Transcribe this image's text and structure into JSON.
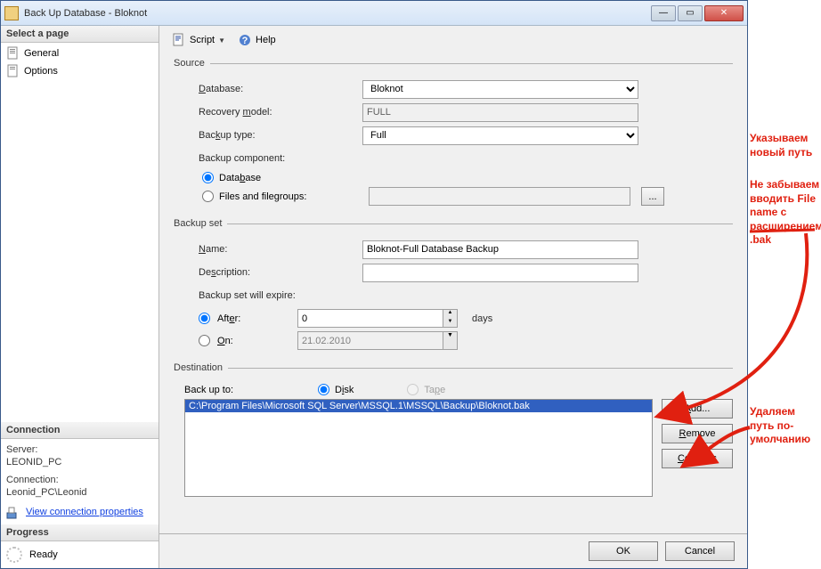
{
  "window": {
    "title": "Back Up Database - Bloknot"
  },
  "sidebar": {
    "select_page": "Select a page",
    "items": [
      {
        "label": "General"
      },
      {
        "label": "Options"
      }
    ],
    "connection_header": "Connection",
    "server_label": "Server:",
    "server_value": "LEONID_PC",
    "connection_label": "Connection:",
    "connection_value": "Leonid_PC\\Leonid",
    "view_properties": "View connection properties",
    "progress_header": "Progress",
    "progress_status": "Ready"
  },
  "toolbar": {
    "script": "Script",
    "help": "Help"
  },
  "source": {
    "legend": "Source",
    "database_label": "Database:",
    "database_value": "Bloknot",
    "recovery_label": "Recovery model:",
    "recovery_value": "FULL",
    "backup_type_label": "Backup type:",
    "backup_type_value": "Full",
    "component_label": "Backup component:",
    "radio_database": "Database",
    "radio_files": "Files and filegroups:",
    "browse": "..."
  },
  "backup_set": {
    "legend": "Backup set",
    "name_label": "Name:",
    "name_value": "Bloknot-Full Database Backup",
    "description_label": "Description:",
    "description_value": "",
    "expire_label": "Backup set will expire:",
    "after_label": "After:",
    "after_value": "0",
    "after_units": "days",
    "on_label": "On:",
    "on_value": "21.02.2010"
  },
  "destination": {
    "legend": "Destination",
    "backup_to_label": "Back up to:",
    "radio_disk": "Disk",
    "radio_tape": "Tape",
    "path": "C:\\Program Files\\Microsoft SQL Server\\MSSQL.1\\MSSQL\\Backup\\Bloknot.bak",
    "add": "Add...",
    "remove": "Remove",
    "contents": "Contents"
  },
  "buttons": {
    "ok": "OK",
    "cancel": "Cancel"
  },
  "annotations": {
    "t1": "Указываем новый путь",
    "t2": "Не забываем вводить File name с расширением .bak",
    "t3": "Удаляем путь по-умолчанию"
  }
}
